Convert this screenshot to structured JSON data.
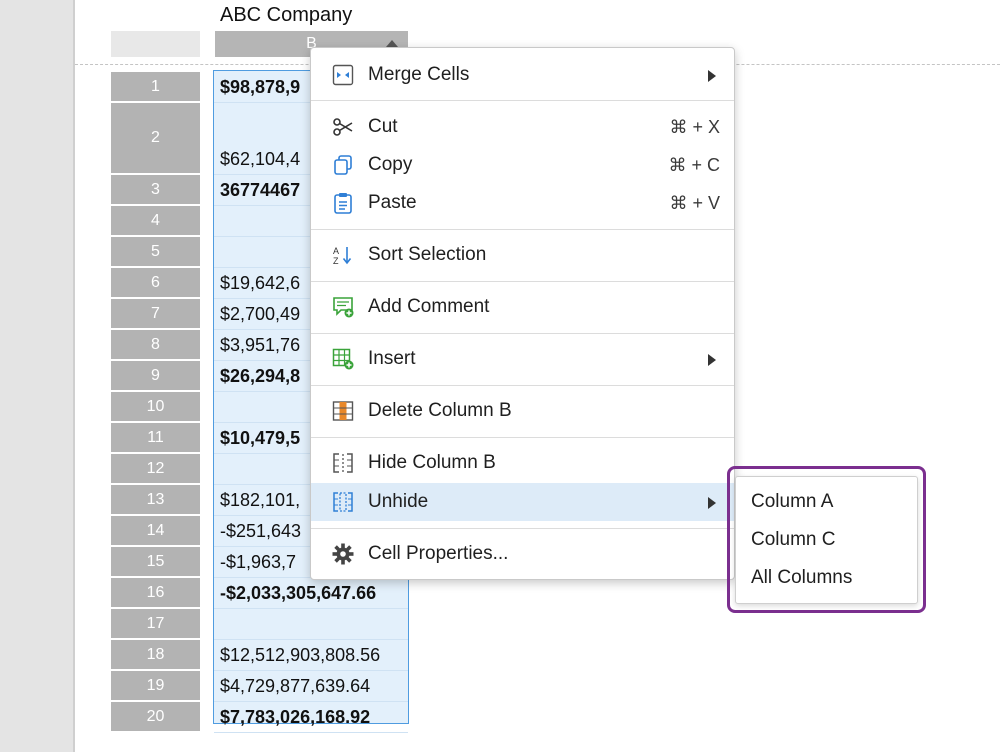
{
  "sheet": {
    "title": "ABC Company",
    "column_header": "B"
  },
  "rows": [
    {
      "num": "1",
      "value": "$98,878,9",
      "bold": true
    },
    {
      "num": "2",
      "value": "$62,104,4",
      "bold": false
    },
    {
      "num": "3",
      "value": "36774467",
      "bold": true
    },
    {
      "num": "4",
      "value": "",
      "bold": false
    },
    {
      "num": "5",
      "value": "",
      "bold": false
    },
    {
      "num": "6",
      "value": "$19,642,6",
      "bold": false
    },
    {
      "num": "7",
      "value": "$2,700,49",
      "bold": false
    },
    {
      "num": "8",
      "value": "$3,951,76",
      "bold": false
    },
    {
      "num": "9",
      "value": "$26,294,8",
      "bold": true
    },
    {
      "num": "10",
      "value": "",
      "bold": false
    },
    {
      "num": "11",
      "value": "$10,479,5",
      "bold": true
    },
    {
      "num": "12",
      "value": "",
      "bold": false
    },
    {
      "num": "13",
      "value": "$182,101,",
      "bold": false
    },
    {
      "num": "14",
      "value": "-$251,643",
      "bold": false
    },
    {
      "num": "15",
      "value": "-$1,963,7",
      "bold": false
    },
    {
      "num": "16",
      "value": "-$2,033,305,647.66",
      "bold": true
    },
    {
      "num": "17",
      "value": "",
      "bold": false
    },
    {
      "num": "18",
      "value": "$12,512,903,808.56",
      "bold": false
    },
    {
      "num": "19",
      "value": "$4,729,877,639.64",
      "bold": false
    },
    {
      "num": "20",
      "value": "$7,783,026,168.92",
      "bold": true
    }
  ],
  "context_menu": {
    "merge_cells": "Merge Cells",
    "cut": "Cut",
    "cut_shortcut": "⌘ + X",
    "copy": "Copy",
    "copy_shortcut": "⌘ + C",
    "paste": "Paste",
    "paste_shortcut": "⌘ + V",
    "sort_selection": "Sort Selection",
    "add_comment": "Add Comment",
    "insert": "Insert",
    "delete_column": "Delete Column B",
    "hide_column": "Hide Column B",
    "unhide": "Unhide",
    "cell_properties": "Cell Properties..."
  },
  "unhide_submenu": {
    "column_a": "Column A",
    "column_c": "Column C",
    "all_columns": "All Columns"
  },
  "icons": {
    "merge": "merge-cells-icon",
    "cut": "scissors-icon",
    "copy": "copy-icon",
    "paste": "clipboard-icon",
    "sort": "sort-az-icon",
    "comment": "add-comment-icon",
    "insert": "insert-grid-icon",
    "delete": "delete-column-icon",
    "hide": "hide-column-icon",
    "unhide": "unhide-column-icon",
    "properties": "gear-icon"
  },
  "colors": {
    "selection_fill": "#e3f0fb",
    "selection_border": "#4f9ce0",
    "header_gray": "#b3b3b3",
    "menu_highlight": "#ddebf8",
    "focus_frame": "#7b2f8f",
    "icon_blue": "#2f7fd6",
    "icon_green": "#3aa33a",
    "icon_orange": "#e8882a"
  }
}
